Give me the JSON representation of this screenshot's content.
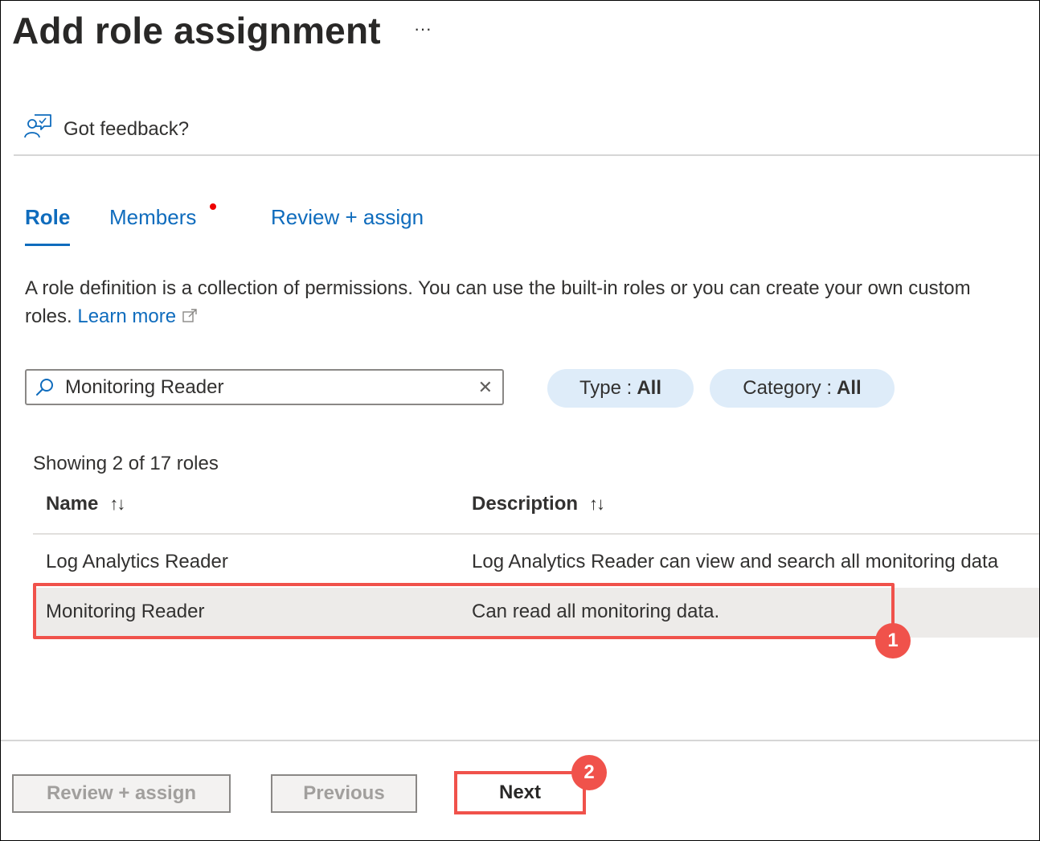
{
  "header": {
    "title": "Add role assignment",
    "more_label": "···"
  },
  "feedback": {
    "icon": "feedback-icon",
    "label": "Got feedback?"
  },
  "tabs": [
    {
      "label": "Role",
      "active": true
    },
    {
      "label": "Members",
      "has_indicator": true
    },
    {
      "label": "Review + assign"
    }
  ],
  "description": {
    "text": "A role definition is a collection of permissions. You can use the built-in roles or you can create your own custom roles.",
    "link_label": "Learn more"
  },
  "search": {
    "value": "Monitoring Reader",
    "clear_label": "✕"
  },
  "filters": [
    {
      "label": "Type :",
      "value": "All"
    },
    {
      "label": "Category :",
      "value": "All"
    }
  ],
  "results_count": "Showing 2 of 17 roles",
  "table": {
    "columns": [
      {
        "label": "Name",
        "sort_glyph": "↑↓"
      },
      {
        "label": "Description",
        "sort_glyph": "↑↓"
      }
    ],
    "rows": [
      {
        "name": "Log Analytics Reader",
        "description": "Log Analytics Reader can view and search all monitoring data",
        "selected": false
      },
      {
        "name": "Monitoring Reader",
        "description": "Can read all monitoring data.",
        "selected": true
      }
    ]
  },
  "annotations": [
    {
      "number": "1"
    },
    {
      "number": "2"
    }
  ],
  "footer": {
    "review_assign_label": "Review + assign",
    "previous_label": "Previous",
    "next_label": "Next"
  },
  "colors": {
    "accent": "#0f6cbd",
    "highlight": "#f0524b",
    "pill_bg": "#deecf9",
    "selected_row": "#edebe9"
  }
}
